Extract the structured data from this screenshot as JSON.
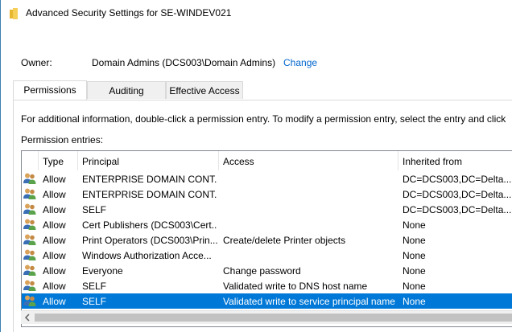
{
  "window": {
    "title": "Advanced Security Settings for SE-WINDEV021"
  },
  "owner": {
    "label": "Owner:",
    "value": "Domain Admins (DCS003\\Domain Admins)",
    "change_link": "Change"
  },
  "tabs": [
    {
      "label": "Permissions",
      "active": true
    },
    {
      "label": "Auditing",
      "active": false
    },
    {
      "label": "Effective Access",
      "active": false
    }
  ],
  "info_text": "For additional information, double-click a permission entry. To modify a permission entry, select the entry and click",
  "entries_label": "Permission entries:",
  "columns": {
    "type": "Type",
    "principal": "Principal",
    "access": "Access",
    "inherited": "Inherited from"
  },
  "rows": [
    {
      "type": "Allow",
      "principal": "ENTERPRISE DOMAIN CONT...",
      "access": "",
      "inherited": "DC=DCS003,DC=Delta...",
      "selected": false
    },
    {
      "type": "Allow",
      "principal": "ENTERPRISE DOMAIN CONT...",
      "access": "",
      "inherited": "DC=DCS003,DC=Delta...",
      "selected": false
    },
    {
      "type": "Allow",
      "principal": "SELF",
      "access": "",
      "inherited": "DC=DCS003,DC=Delta...",
      "selected": false
    },
    {
      "type": "Allow",
      "principal": "Cert Publishers (DCS003\\Cert...",
      "access": "",
      "inherited": "None",
      "selected": false
    },
    {
      "type": "Allow",
      "principal": "Print Operators (DCS003\\Prin...",
      "access": "Create/delete Printer objects",
      "inherited": "None",
      "selected": false
    },
    {
      "type": "Allow",
      "principal": "Windows Authorization Acce...",
      "access": "",
      "inherited": "None",
      "selected": false
    },
    {
      "type": "Allow",
      "principal": "Everyone",
      "access": "Change password",
      "inherited": "None",
      "selected": false
    },
    {
      "type": "Allow",
      "principal": "SELF",
      "access": "Validated write to DNS host name",
      "inherited": "None",
      "selected": false
    },
    {
      "type": "Allow",
      "principal": "SELF",
      "access": "Validated write to service principal name",
      "inherited": "None",
      "selected": true
    }
  ],
  "colors": {
    "selection": "#0078d7",
    "link": "#0066cc"
  }
}
